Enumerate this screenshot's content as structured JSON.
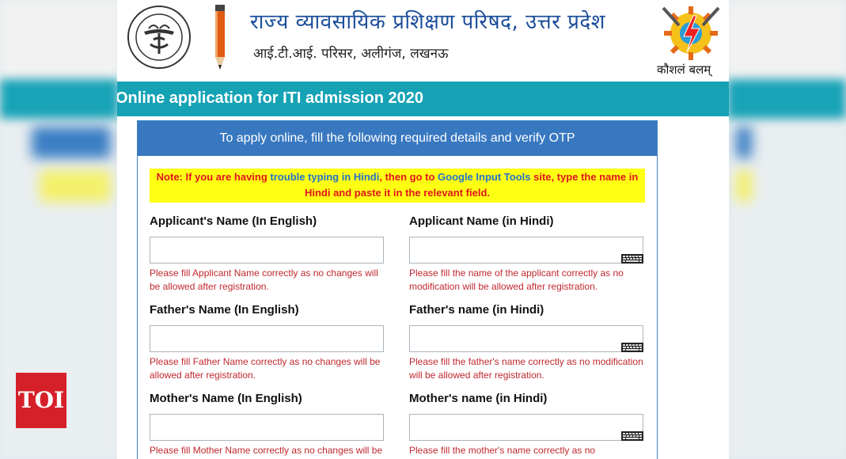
{
  "header": {
    "hindi_title": "राज्य व्यावसायिक प्रशिक्षण परिषद, उत्तर प्रदेश",
    "hindi_subtitle": "आई.टी.आई. परिसर, अलीगंज, लखनऊ",
    "emblem_text": "उत्तर प्रदेश सरकार",
    "skill_logo_text": "कौशलं बलम्"
  },
  "banner": {
    "title": "Online application for ITI admission 2020"
  },
  "panel": {
    "heading": "To apply online, fill the following required details and verify OTP",
    "note": {
      "part1": "Note: If you are having ",
      "link1": "trouble typing in Hindi",
      "part2": ", then go to ",
      "link2": "Google Input Tools",
      "part3": " site, type the name in Hindi and paste it in the relevant field."
    },
    "fields": [
      {
        "label": "Applicant's Name (In English)",
        "value": "",
        "help": "Please fill Applicant Name correctly as no changes will be allowed after registration."
      },
      {
        "label": "Applicant Name (in Hindi)",
        "value": "",
        "help": "Please fill the name of the applicant correctly as no modification will be allowed after registration."
      },
      {
        "label": "Father's Name (In English)",
        "value": "",
        "help": "Please fill Father Name correctly as no changes will be allowed after registration."
      },
      {
        "label": "Father's name (in Hindi)",
        "value": "",
        "help": "Please fill the father's name correctly as no modification will be allowed after registration."
      },
      {
        "label": "Mother's Name (In English)",
        "value": "",
        "help": "Please fill Mother Name correctly as no changes will be allowed after registration."
      },
      {
        "label": "Mother's name (in Hindi)",
        "value": "",
        "help": "Please fill the mother's name correctly as no modification will be allowed after registration."
      }
    ]
  },
  "overlay": {
    "logo_text": "TOI"
  },
  "colors": {
    "banner": "#16a2b5",
    "panel_header": "#3878c0",
    "note_bg": "#ffff14",
    "note_text": "#e2141c",
    "help_text": "#c0282e",
    "title_blue": "#1b4e9b"
  }
}
